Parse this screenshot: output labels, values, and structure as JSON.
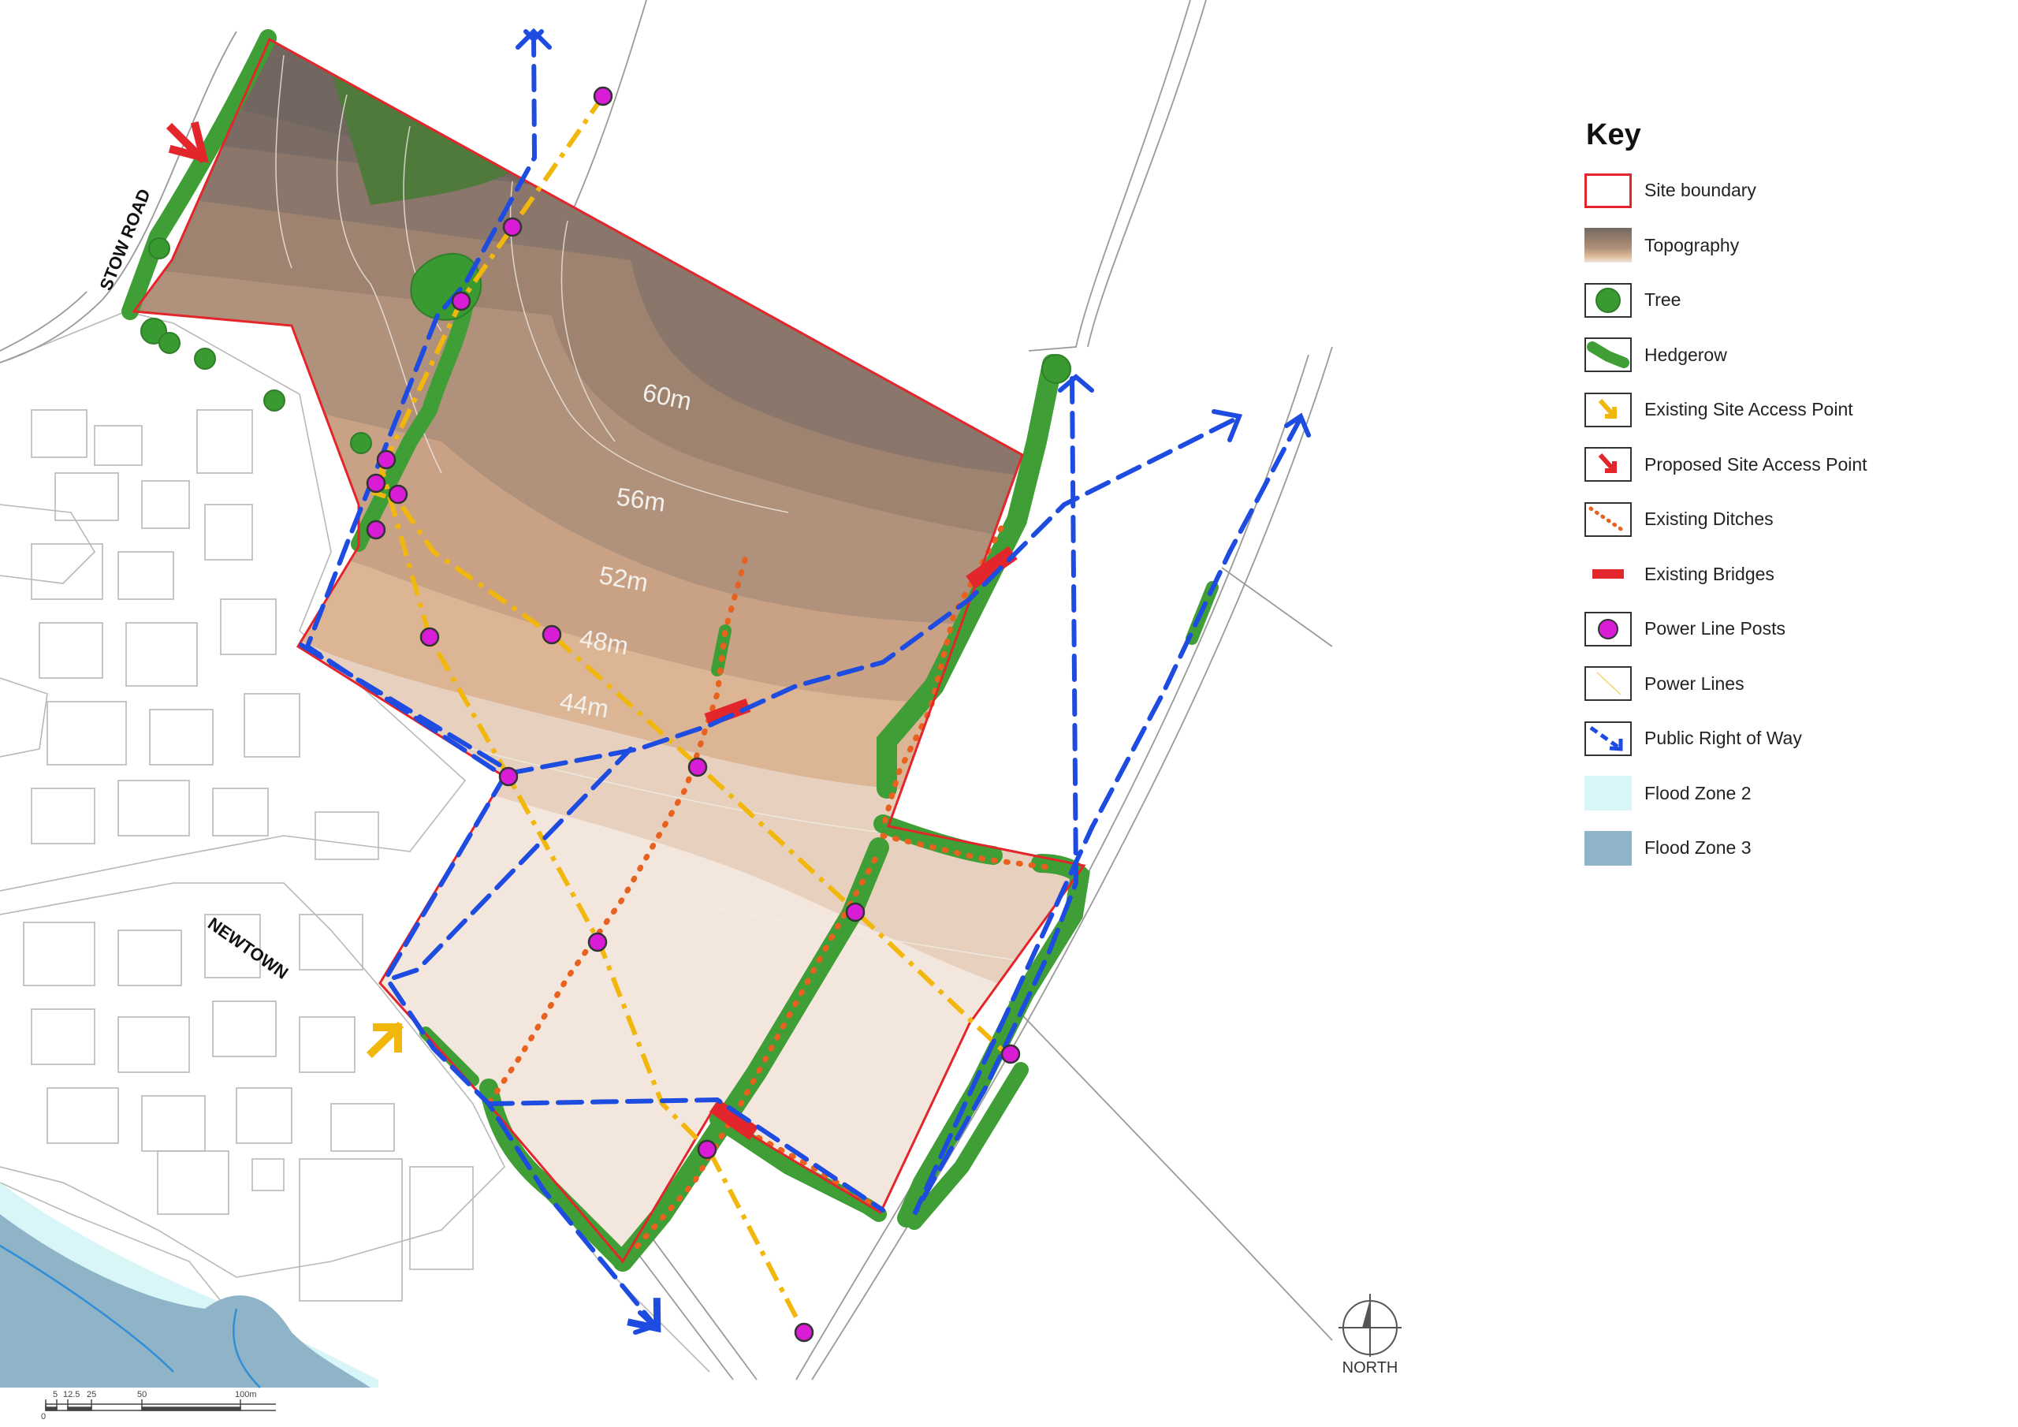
{
  "key": {
    "title": "Key",
    "items": [
      {
        "label": "Site boundary",
        "icon": "site-boundary-swatch"
      },
      {
        "label": "Topography",
        "icon": "topography-swatch"
      },
      {
        "label": "Tree",
        "icon": "tree-icon"
      },
      {
        "label": "Hedgerow",
        "icon": "hedgerow-icon"
      },
      {
        "label": "Existing Site Access Point",
        "icon": "yellow-arrow-icon"
      },
      {
        "label": "Proposed Site Access Point",
        "icon": "red-arrow-icon"
      },
      {
        "label": "Existing Ditches",
        "icon": "dotted-line-icon"
      },
      {
        "label": "Existing Bridges",
        "icon": "bridge-icon"
      },
      {
        "label": "Power Line Posts",
        "icon": "power-post-icon"
      },
      {
        "label": "Power Lines",
        "icon": "power-line-icon"
      },
      {
        "label": "Public Right of Way",
        "icon": "dashed-arrow-icon"
      },
      {
        "label": "Flood Zone 2",
        "icon": "flood-zone-2-swatch"
      },
      {
        "label": "Flood Zone 3",
        "icon": "flood-zone-3-swatch"
      }
    ]
  },
  "map": {
    "road_labels": {
      "stow_road": "STOW ROAD",
      "newtown": "NEWTOWN"
    },
    "contours": {
      "c60": "60m",
      "c56": "56m",
      "c52": "52m",
      "c48": "48m",
      "c44": "44m"
    },
    "north_label": "NORTH",
    "scale": {
      "t0": "0",
      "t5": "5",
      "t12": "12.5",
      "t25": "25",
      "t50": "50",
      "t100": "100m"
    }
  },
  "colors": {
    "boundary": "#e3262c",
    "hedge": "#3f9e35",
    "tree": "#2f7f2a",
    "row": "#1e4be0",
    "power_line": "#f2b70c",
    "ditch": "#e8611f",
    "post": "#d91cd6",
    "flood2": "#d8f6f8",
    "flood3": "#8fb3c7",
    "topo_dark": "#716660",
    "topo_light": "#f3e6dc"
  }
}
